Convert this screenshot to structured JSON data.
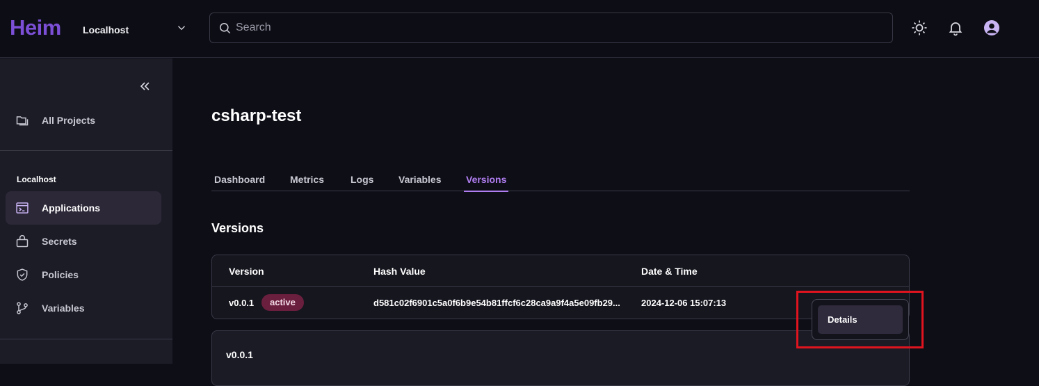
{
  "header": {
    "logo": "Heim",
    "environment": "Localhost",
    "search_placeholder": "Search"
  },
  "sidebar": {
    "all_projects": "All Projects",
    "section_title": "Localhost",
    "items": [
      {
        "label": "Applications",
        "icon": "terminal-window-icon",
        "active": true
      },
      {
        "label": "Secrets",
        "icon": "briefcase-icon"
      },
      {
        "label": "Policies",
        "icon": "shield-check-icon"
      },
      {
        "label": "Variables",
        "icon": "git-branch-icon"
      }
    ]
  },
  "main": {
    "title": "csharp-test",
    "tabs": [
      "Dashboard",
      "Metrics",
      "Logs",
      "Variables",
      "Versions"
    ],
    "active_tab": "Versions",
    "section_heading": "Versions",
    "table": {
      "columns": [
        "Version",
        "Hash Value",
        "Date & Time"
      ],
      "rows": [
        {
          "version": "v0.0.1",
          "badge": "active",
          "hash": "d581c02f6901c5a0f6b9e54b81ffcf6c28ca9a9f4a5e09fb29...",
          "datetime": "2024-12-06 15:07:13"
        }
      ]
    },
    "expanded_card_title": "v0.0.1",
    "context_menu": {
      "item": "Details"
    }
  },
  "colors": {
    "accent": "#7b4fd6",
    "active_tab": "#b07ef0",
    "badge_bg": "#6b1f3e",
    "highlight": "#e0141f"
  }
}
